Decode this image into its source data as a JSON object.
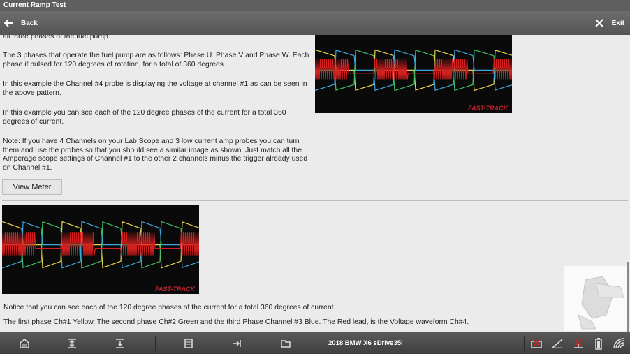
{
  "window": {
    "title": "Current Ramp Test"
  },
  "nav": {
    "back_label": "Back",
    "exit_label": "Exit"
  },
  "content": {
    "paragraphs": [
      "all three phases of the fuel pump.",
      "The 3 phases that operate the fuel pump are as follows: Phase U. Phase V and Phase W. Each phase if pulsed for 120 degrees of rotation, for a total of 360 degrees.",
      "In this example the Channel #4 probe is displaying the voltage at channel #1 as can be seen in the above pattern.",
      "In this example you can see each of the 120 degree phases of the current for a total 360 degrees of current.",
      "Note: If you have 4 Channels on your Lab Scope and 3 low current amp probes you can turn them and use the probes so that you should see a similar image as shown. Just match all the Amperage scope settings of Channel #1 to the other 2 channels minus the trigger already used on Channel #1."
    ],
    "view_meter_label": "View Meter",
    "scope_logo": "FAST-TRACK",
    "note_line_1": "Notice that you can see each of the 120 degree phases of the current for a total 360 degrees of current.",
    "note_line_2": "The first phase Ch#1 Yellow, The second phase Ch#2 Green and the third Phase Channel #3 Blue. The Red lead, is the Voltage waveform Ch#4."
  },
  "status": {
    "vehicle": "2018 BMW X6 sDrive35i"
  },
  "icons": [
    "arrow-left-icon",
    "close-icon",
    "home-icon",
    "expand-icon",
    "collapse-icon",
    "report-icon",
    "export-icon",
    "folder-icon",
    "scope-disconnect-icon",
    "meter-disconnect-icon",
    "vehicle-disconnect-icon",
    "battery-icon",
    "wifi-icon"
  ],
  "colors": {
    "yellow_trace": "#e8d24a",
    "green_trace": "#3fbf6a",
    "blue_trace": "#3fa6d8",
    "red_trace": "#d21f1f",
    "logo": "#c0262d"
  }
}
